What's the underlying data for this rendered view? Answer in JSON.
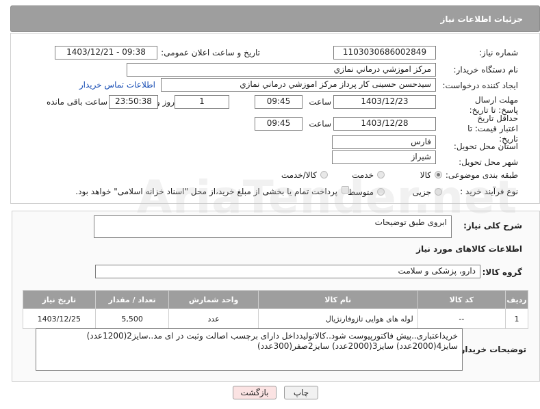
{
  "header": {
    "title": "جزئیات اطلاعات نیاز"
  },
  "fields": {
    "need_number_label": "شماره نیاز:",
    "need_number": "1103030686002849",
    "announce_label": "تاریخ و ساعت اعلان عمومی:",
    "announce_value": "1403/12/21 - 09:38",
    "buyer_org_label": "نام دستگاه خریدار:",
    "buyer_org": "مرکز اموزشي درماني نمازي",
    "creator_label": "ایجاد کننده درخواست:",
    "creator": "سیدحسن حسینی کار پرداز مرکز اموزشي درماني نمازي",
    "contact_link": "اطلاعات تماس خریدار",
    "reply_deadline_label": "مهلت ارسال پاسخ: تا تاریخ:",
    "reply_date": "1403/12/23",
    "time_label": "ساعت",
    "reply_time": "09:45",
    "days_value": "1",
    "days_label": "روز و",
    "remaining_time": "23:50:38",
    "remaining_label": "ساعت باقی مانده",
    "validity_label": "حداقل تاریخ اعتبار قیمت: تا تاریخ:",
    "validity_date": "1403/12/28",
    "validity_time": "09:45",
    "province_label": "استان محل تحویل:",
    "province": "فارس",
    "city_label": "شهر محل تحویل:",
    "city": "شیراز",
    "category_label": "طبقه بندی موضوعی:",
    "category_options": [
      "کالا",
      "خدمت",
      "کالا/خدمت"
    ],
    "process_label": "نوع فرآیند خرید :",
    "process_options": [
      "جزیی",
      "متوسط"
    ],
    "payment_note": "پرداخت تمام یا بخشی از مبلغ خرید،از محل \"اسناد خزانه اسلامی\" خواهد بود."
  },
  "summary": {
    "description_label": "شرح کلی نیاز:",
    "description": "ابروی طبق توضیحات",
    "goods_info_title": "اطلاعات کالاهای مورد نیاز",
    "goods_group_label": "گروه کالا:",
    "goods_group": "دارو، پزشکی و سلامت"
  },
  "table": {
    "headers": [
      "ردیف",
      "کد کالا",
      "نام کالا",
      "واحد شمارش",
      "تعداد / مقدار",
      "تاریخ نیاز"
    ],
    "rows": [
      [
        "1",
        "--",
        "لوله های هوایی تازوفارنژیال",
        "عدد",
        "5,500",
        "1403/12/25"
      ]
    ]
  },
  "buyer_notes": {
    "label": "توضیحات خریدار:",
    "line1": "خریداعتباری..پیش فاکتورپیوست شود..کالاتولیدداخل دارای برچسب اصالت وثبت در ای مد..سایز2(1200عدد)",
    "line2": "سایز4(2000عدد) سایز3(2000عدد) سایز2صفر(300عدد)"
  },
  "buttons": {
    "print": "چاپ",
    "back": "بازگشت"
  },
  "watermark": "AriaTender.net"
}
